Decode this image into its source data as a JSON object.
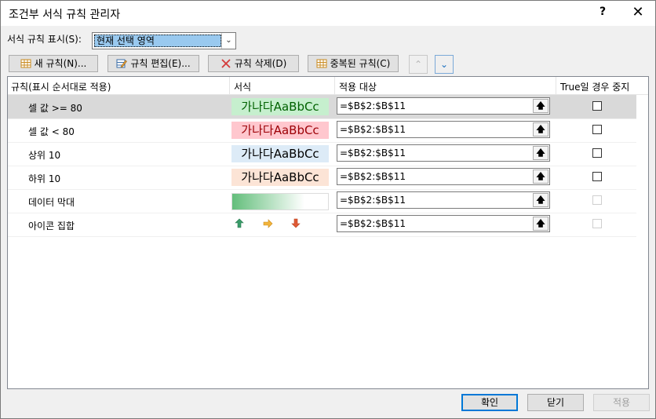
{
  "window": {
    "title": "조건부 서식 규칙 관리자",
    "help": "?",
    "close": "✕"
  },
  "show": {
    "label": "서식 규칙 표시(S):",
    "value": "현재 선택 영역"
  },
  "toolbar": {
    "new_rule": "새 규칙(N)...",
    "edit_rule": "규칙 편집(E)...",
    "delete_rule": "규칙 삭제(D)",
    "duplicate_rule": "중복된 규칙(C)"
  },
  "columns": {
    "rule": "규칙(표시 순서대로 적용)",
    "format": "서식",
    "applies_to": "적용 대상",
    "stop_if_true": "True일 경우 중지"
  },
  "rules": [
    {
      "name": "셀 값 >= 80",
      "preview": "가나다AaBbCc",
      "bg": "#c6efce",
      "fg": "#006100",
      "applies": "=$B$2:$B$11"
    },
    {
      "name": "셀 값 < 80",
      "preview": "가나다AaBbCc",
      "bg": "#ffc7ce",
      "fg": "#9c0006",
      "applies": "=$B$2:$B$11"
    },
    {
      "name": "상위 10",
      "preview": "가나다AaBbCc",
      "bg": "#ddebf7",
      "fg": "#000000",
      "applies": "=$B$2:$B$11"
    },
    {
      "name": "하위 10",
      "preview": "가나다AaBbCc",
      "bg": "#fce4d6",
      "fg": "#000000",
      "applies": "=$B$2:$B$11"
    },
    {
      "name": "데이터 막대",
      "applies": "=$B$2:$B$11"
    },
    {
      "name": "아이콘 집합",
      "applies": "=$B$2:$B$11"
    }
  ],
  "footer": {
    "ok": "확인",
    "close": "닫기",
    "apply": "적용"
  }
}
